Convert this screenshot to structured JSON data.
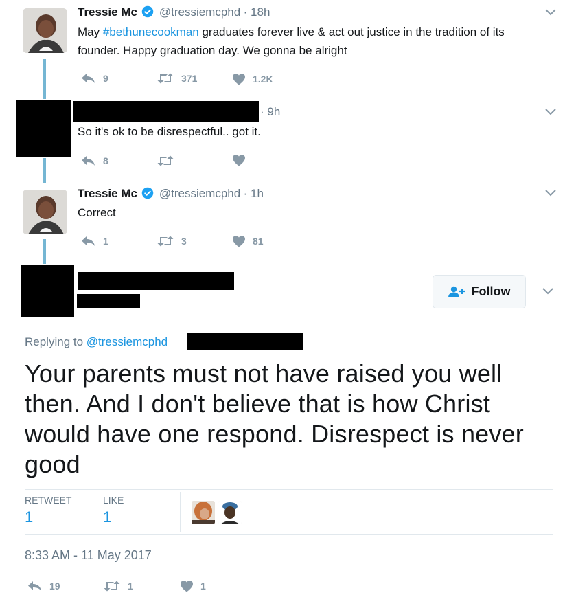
{
  "tweets": [
    {
      "name": "Tressie Mc",
      "handle": "@tressiemcphd",
      "time": "· 18h",
      "text_before": "May ",
      "hashtag": "#bethunecookman",
      "text_after": " graduates forever live & act out justice in the tradition of its founder. Happy graduation day. We gonna be alright",
      "replies": "9",
      "retweets": "371",
      "likes": "1.2K"
    },
    {
      "time": "· 9h",
      "text": "So it's ok to be disrespectful.. got it.",
      "replies": "8",
      "retweets": "",
      "likes": ""
    },
    {
      "name": "Tressie Mc",
      "handle": "@tressiemcphd",
      "time": "· 1h",
      "text": "Correct",
      "replies": "1",
      "retweets": "3",
      "likes": "81"
    }
  ],
  "main_tweet": {
    "follow_label": "Follow",
    "replying_prefix": "Replying to ",
    "replying_handle": "@tressiemcphd",
    "text": "Your parents must not have raised you well then. And I don't believe that is how Christ would have one respond. Disrespect is never good",
    "retweet_label": "RETWEET",
    "retweet_count": "1",
    "like_label": "LIKE",
    "like_count": "1",
    "timestamp": "8:33 AM - 11 May 2017",
    "replies": "19",
    "retweets": "1",
    "likes": "1"
  },
  "colors": {
    "link": "#1b95e0",
    "thread_line": "#75b6d3",
    "muted": "#657786",
    "action": "#8899a6"
  }
}
